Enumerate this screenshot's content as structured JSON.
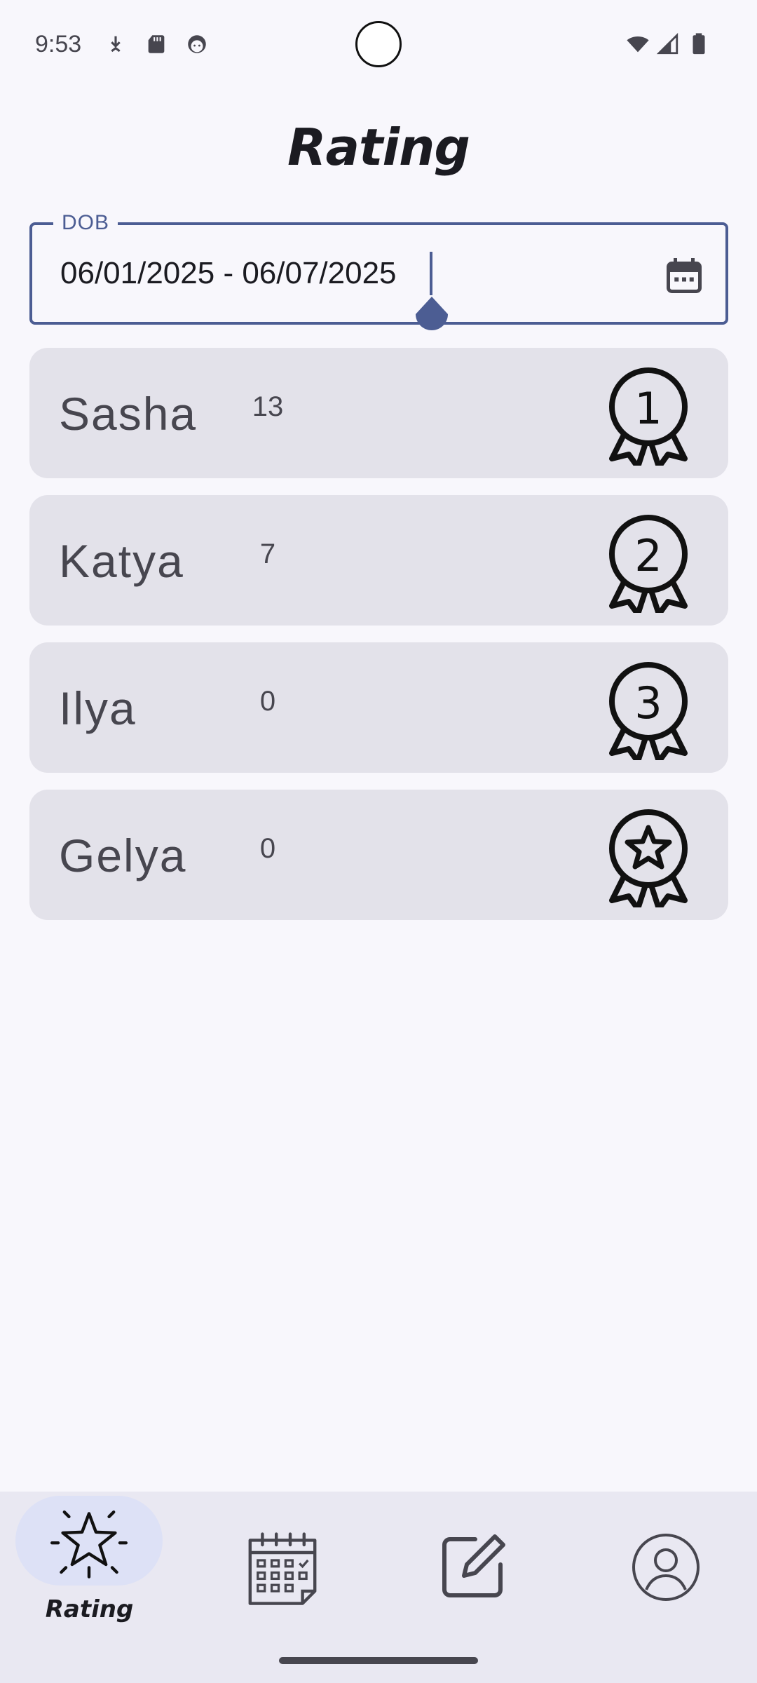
{
  "status_bar": {
    "time": "9:53",
    "icons": [
      "download-icon",
      "sd-card-icon",
      "face-icon",
      "wifi-icon",
      "signal-icon",
      "battery-icon"
    ]
  },
  "header": {
    "title": "Rating"
  },
  "date_field": {
    "label": "DOB",
    "value": "06/01/2025 - 06/07/2025",
    "icon": "calendar-icon"
  },
  "ratings": [
    {
      "name": "Sasha",
      "score": "13",
      "badge": "1",
      "icon": "medal-1-icon"
    },
    {
      "name": "Katya",
      "score": "7",
      "badge": "2",
      "icon": "medal-2-icon"
    },
    {
      "name": "Ilya",
      "score": "0",
      "badge": "3",
      "icon": "medal-3-icon"
    },
    {
      "name": "Gelya",
      "score": "0",
      "badge": "",
      "icon": "medal-star-icon"
    }
  ],
  "bottom_nav": {
    "items": [
      {
        "label": "Rating",
        "icon": "sparkle-star-icon",
        "active": true
      },
      {
        "label": "",
        "icon": "calendar-grid-icon",
        "active": false
      },
      {
        "label": "",
        "icon": "edit-icon",
        "active": false
      },
      {
        "label": "",
        "icon": "account-icon",
        "active": false
      }
    ]
  },
  "colors": {
    "background": "#f8f7fc",
    "accent": "#4c5d93",
    "row_background": "#e3e2ea",
    "nav_background": "#e9e8f2",
    "nav_active_pill": "#dde1f6"
  }
}
